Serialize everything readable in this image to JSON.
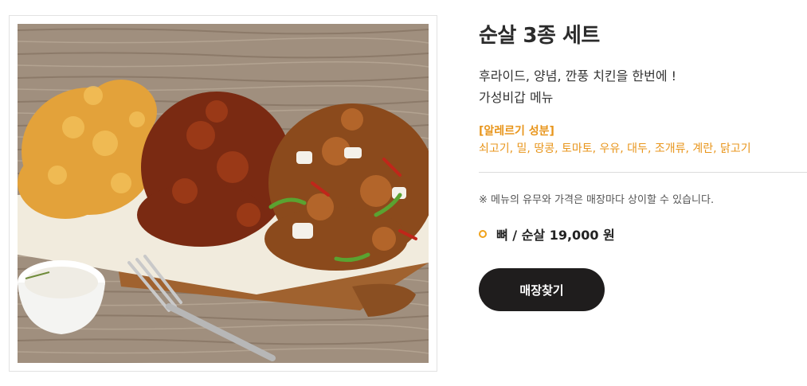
{
  "product": {
    "title": "순살 3종 세트",
    "description_lines": [
      "후라이드, 양념, 깐풍 치킨을 한번에 !",
      "가성비갑 메뉴"
    ],
    "allergy_heading": "[알레르기 성분]",
    "allergy_list": "쇠고기, 밀, 땅콩, 토마토, 우유, 대두, 조개류, 계란, 닭고기",
    "notice": "※ 메뉴의 유무와 가격은 매장마다 상이할 수 있습니다.",
    "price": "뼈 / 순살 19,000 원",
    "find_store_label": "매장찾기"
  },
  "colors": {
    "accent": "#e8951b",
    "button_bg": "#1f1d1d",
    "divider": "#dcdcdc"
  },
  "icons": {
    "price_bullet": "circle-bullet-icon"
  }
}
